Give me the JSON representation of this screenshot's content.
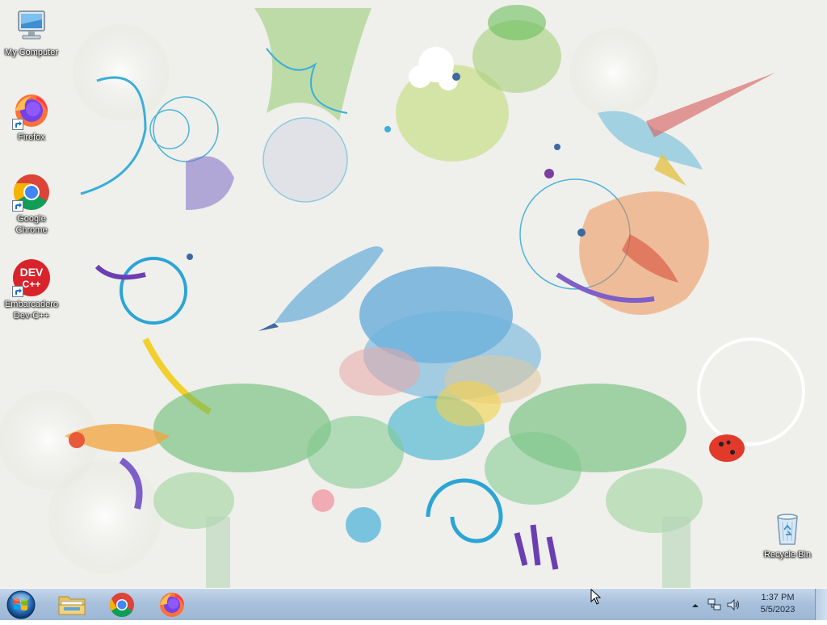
{
  "desktop": {
    "icons": [
      {
        "label": "My Computer",
        "icon": "computer-icon"
      },
      {
        "label": "Firefox",
        "icon": "firefox-icon"
      },
      {
        "label": "Google Chrome",
        "icon": "chrome-icon"
      },
      {
        "label": "Embarcadero Dev-C++",
        "icon": "devcpp-icon"
      },
      {
        "label": "Recycle Bin",
        "icon": "recycle-bin-icon"
      }
    ],
    "devcpp_logo_text": [
      "DEV",
      "C++"
    ]
  },
  "taskbar": {
    "start_icon": "windows-logo-icon",
    "pinned": [
      {
        "name": "File Explorer",
        "icon": "folder-icon"
      },
      {
        "name": "Google Chrome",
        "icon": "chrome-icon"
      },
      {
        "name": "Firefox",
        "icon": "firefox-icon"
      }
    ],
    "tray": {
      "icons": [
        "show-hidden-icons-icon",
        "network-icon",
        "volume-icon"
      ],
      "time": "1:37 PM",
      "date": "5/5/2023"
    }
  },
  "colors": {
    "taskbar": "#a9c1dc",
    "desktop_bg": "#eeeeea",
    "firefox_orange": "#ff7139",
    "chrome_red": "#db4437",
    "chrome_yellow": "#f4b400",
    "chrome_green": "#0f9d58",
    "chrome_blue": "#4285f4",
    "devcpp_red": "#d9232a"
  }
}
